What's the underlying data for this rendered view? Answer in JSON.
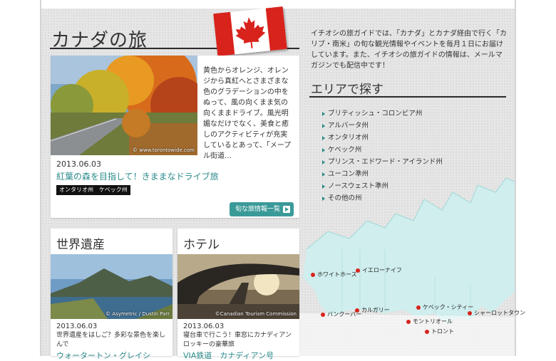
{
  "page": {
    "title": "カナダの旅"
  },
  "featured": {
    "photo_credit": "© www.torontowide.com",
    "description": "黄色からオレンジ、オレンジから真紅へとさまざまな色のグラデーションの中をぬって、風の向くまま気の向くままドライブ。風光明媚なだけでなく、美食と癒しのアクティビティが充実しているとあって、「メープル街道…",
    "date": "2013.06.03",
    "headline": "紅葉の森を目指して！きままなドライブ旅",
    "tags": [
      "オンタリオ州",
      "ケベック州"
    ],
    "more_button": "旬な旅情報一覧"
  },
  "sections": [
    {
      "title": "世界遺産",
      "photo_credit": "© Asymetric / Dustin Parr",
      "date": "2013.06.03",
      "description": "世界遺産をはしご？多彩な景色を楽しんで",
      "link": "ウォータートン・グレイシ"
    },
    {
      "title": "ホテル",
      "photo_credit": "©Canadian Tourism Commission",
      "date": "2013.06.03",
      "description": "寝台車で行こう！車窓にカナディアンロッキーの豪華旅",
      "link": "VIA鉄道　カナディアン号"
    }
  ],
  "sidebar": {
    "intro": "イチオシの旅ガイドでは、「カナダ」とカナダ経由で行く「カリブ・南米」の旬な観光情報やイベントを毎月１日にお届けしています。また、イチオシの旅ガイドの情報は、メールマガジンでも配信中です！",
    "area_title": "エリアで探す",
    "areas": [
      "ブリティッシュ・コロンビア州",
      "アルバータ州",
      "オンタリオ州",
      "ケベック州",
      "プリンス・エドワード・アイランド州",
      "ユーコン準州",
      "ノースウェスト準州",
      "その他の州"
    ]
  },
  "map": {
    "cities": [
      "ホワイトホース",
      "イエローナイフ",
      "バンクーバー",
      "カルガリー",
      "ケベック・シティー",
      "シャーロットタウン",
      "モントリオール",
      "トロント"
    ]
  },
  "colors": {
    "accent": "#2a8a8a",
    "button": "#3a9a98",
    "flag_red": "#d8231c",
    "map_land": "#cfeeed",
    "city_dot": "#d8231c"
  }
}
